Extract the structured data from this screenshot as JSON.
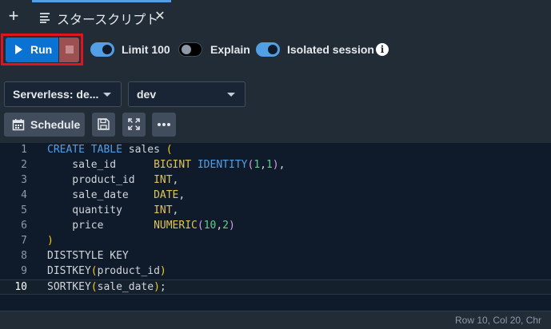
{
  "tabs": {
    "tab1_title": "スタースクリプト"
  },
  "toolbar": {
    "run_label": "Run",
    "toggles": [
      {
        "label": "Limit 100",
        "on": true
      },
      {
        "label": "Explain",
        "on": false
      },
      {
        "label": "Isolated session",
        "on": true
      }
    ],
    "info_glyph": "i"
  },
  "selects": {
    "workgroup": "Serverless: de...",
    "database": "dev"
  },
  "actions": {
    "schedule_label": "Schedule"
  },
  "editor": {
    "line_numbers": [
      "1",
      "2",
      "3",
      "4",
      "5",
      "6",
      "7",
      "8",
      "9",
      "10"
    ],
    "active_line": 10
  },
  "status": {
    "position": "Row 10,  Col 20,  Chr"
  },
  "colors": {
    "accent": "#0972d3",
    "highlight_box": "#e0141e",
    "keyword": "#539fe5",
    "type": "#dec45a",
    "number": "#5fcf8f"
  },
  "icons": {
    "new_tab": "plus-icon",
    "tab": "script-icon",
    "close": "close-icon",
    "run": "play-icon",
    "stop": "stop-icon",
    "info": "info-icon",
    "schedule": "calendar-icon",
    "save": "save-icon",
    "fullscreen": "fullscreen-icon",
    "more": "more-icon"
  }
}
